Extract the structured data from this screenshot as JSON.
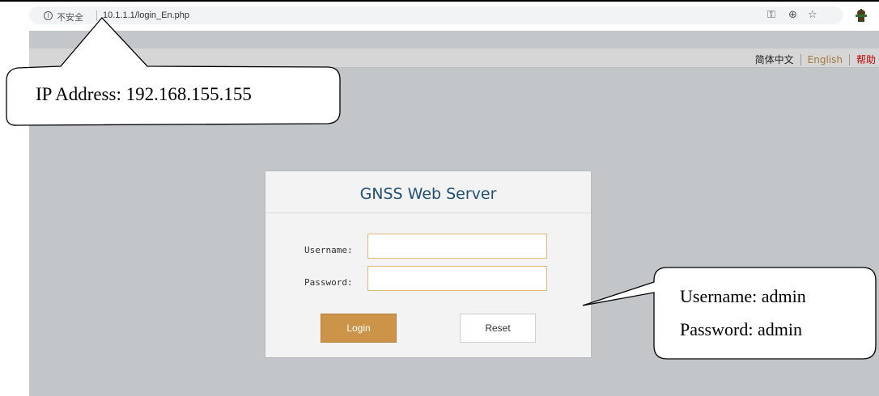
{
  "browser": {
    "security_label": "不安全",
    "url": "10.1.1.1/login_En.php",
    "icons": [
      "info-icon",
      "key-icon",
      "zoom-icon",
      "star-icon",
      "extension-icon"
    ]
  },
  "language_bar": {
    "chinese": "简体中文",
    "english": "English",
    "help": "帮助"
  },
  "login": {
    "title": "GNSS Web Server",
    "username_label": "Username:",
    "password_label": "Password:",
    "username_value": "",
    "password_value": "",
    "login_button": "Login",
    "reset_button": "Reset"
  },
  "annotations": {
    "ip_callout": "IP Address: 192.168.155.155",
    "credentials_line1": "Username: admin",
    "credentials_line2": "Password: admin"
  },
  "colors": {
    "page_background": "#c3c6c9",
    "title_color": "#1e4f70",
    "login_button": "#cc9448",
    "input_border": "#e0b87a",
    "help_link": "#c00000"
  }
}
